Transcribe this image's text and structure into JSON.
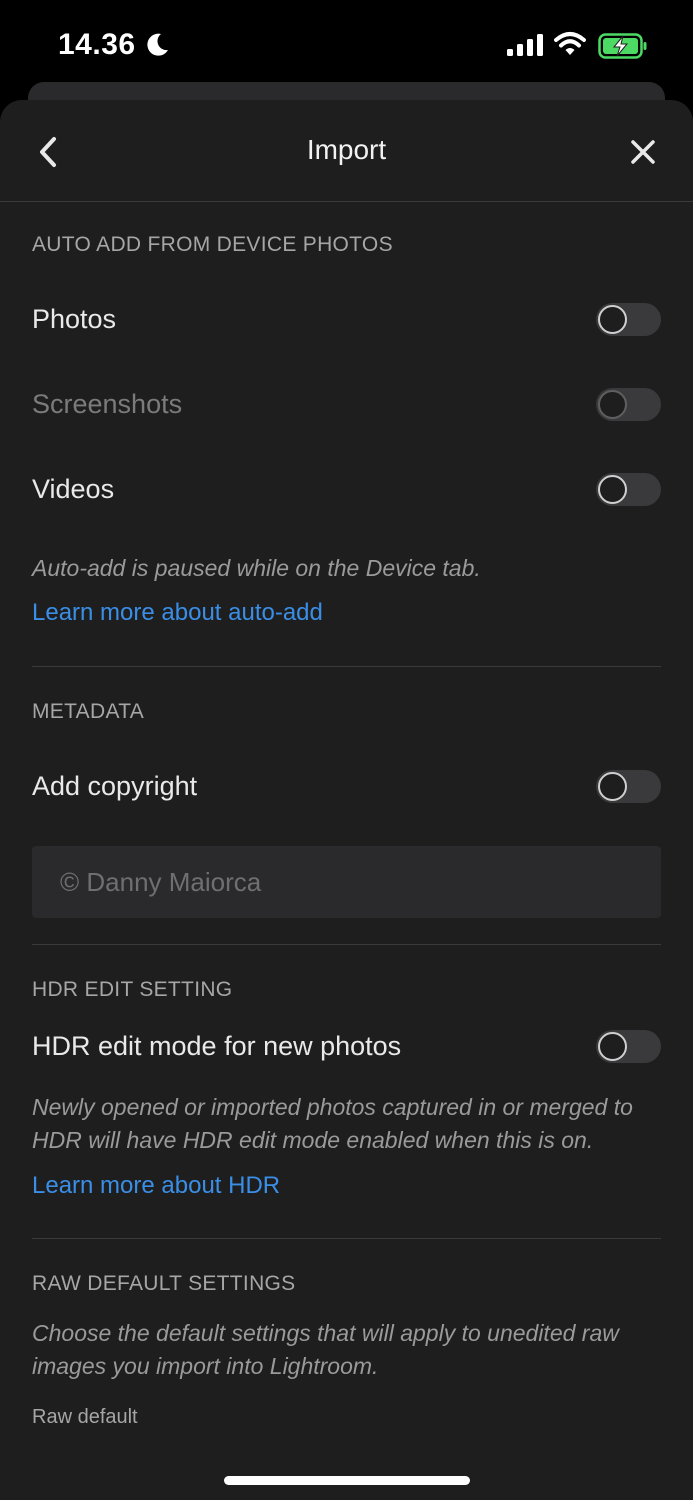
{
  "status_bar": {
    "time": "14.36",
    "icons": [
      "moon-icon",
      "signal-icon",
      "wifi-icon",
      "battery-charging-icon"
    ],
    "battery_color": "#4cd964"
  },
  "header": {
    "title": "Import",
    "back_icon": "chevron-left-icon",
    "close_icon": "close-icon"
  },
  "auto_add": {
    "section_label": "AUTO ADD FROM DEVICE PHOTOS",
    "rows": [
      {
        "label": "Photos",
        "enabled": false,
        "disabled": false
      },
      {
        "label": "Screenshots",
        "enabled": false,
        "disabled": true
      },
      {
        "label": "Videos",
        "enabled": false,
        "disabled": false
      }
    ],
    "note": "Auto-add is paused while on the Device tab.",
    "link": "Learn more about auto-add"
  },
  "metadata": {
    "section_label": "METADATA",
    "add_copyright_label": "Add copyright",
    "add_copyright_enabled": false,
    "copyright_value": "© Danny Maiorca"
  },
  "hdr": {
    "section_label": "HDR EDIT SETTING",
    "toggle_label": "HDR edit mode for new photos",
    "toggle_enabled": false,
    "note": "Newly opened or imported photos captured in or merged to HDR will have HDR edit mode enabled when this is on.",
    "link": "Learn more about HDR"
  },
  "raw": {
    "section_label": "RAW DEFAULT SETTINGS",
    "note": "Choose the default settings that will apply to unedited raw images you import into Lightroom.",
    "raw_default_label": "Raw default"
  },
  "colors": {
    "background": "#1e1e1f",
    "link": "#3a8ee6"
  }
}
